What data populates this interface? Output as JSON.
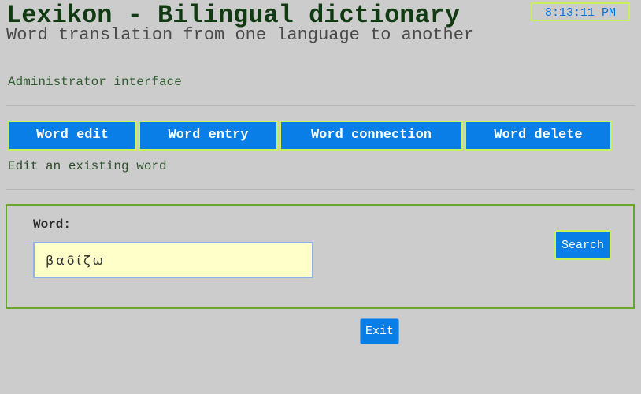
{
  "header": {
    "title": "Lexikon - Bilingual dictionary",
    "subtitle": "Word translation from one language to another",
    "admin_label": "Administrator interface",
    "clock": "8:13:11 PM"
  },
  "tabs": [
    {
      "label": "Word edit"
    },
    {
      "label": "Word entry"
    },
    {
      "label": "Word connection"
    },
    {
      "label": "Word delete"
    }
  ],
  "mode_description": "Edit an existing word",
  "search": {
    "word_label": "Word:",
    "word_value": "βαδίζω",
    "search_label": "Search"
  },
  "exit_label": "Exit",
  "colors": {
    "background": "#cccccc",
    "button_blue": "#087ee6",
    "button_border": "#c9f25a",
    "input_background": "#ffffc9",
    "panel_border": "#6aa72e",
    "title_green": "#123a12",
    "clock_text": "#0a72d8"
  }
}
